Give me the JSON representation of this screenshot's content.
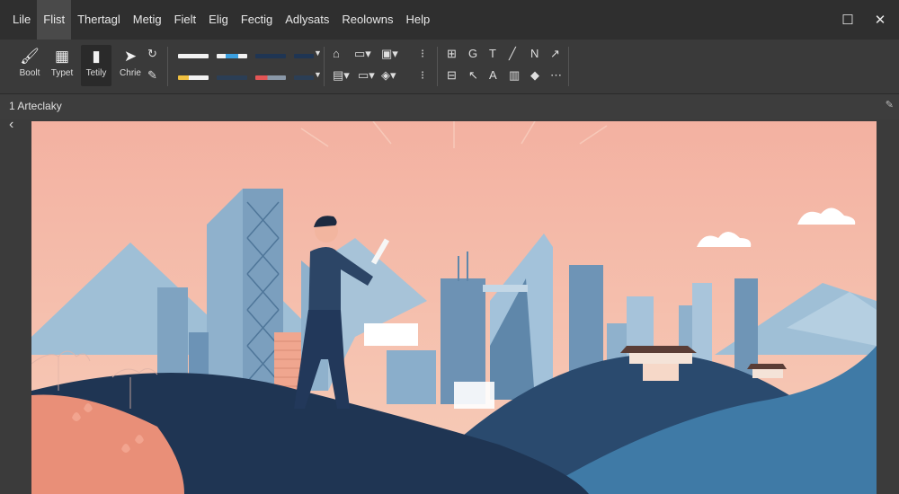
{
  "menu": [
    "Lile",
    "Flist",
    "Thertagl",
    "Metig",
    "Fielt",
    "Elig",
    "Fectig",
    "Adlysats",
    "Reolowns",
    "Help"
  ],
  "active_menu_index": 1,
  "window": {
    "maximize_icon": "maximize-icon",
    "close_icon": "close-icon"
  },
  "toolbar": {
    "tools": [
      {
        "label": "Boolt",
        "icon": "brush-icon"
      },
      {
        "label": "Typet",
        "icon": "basket-icon"
      },
      {
        "label": "Tetily",
        "icon": "page-icon"
      },
      {
        "label": "Chrie",
        "icon": "cursor-icon"
      }
    ],
    "active_tool_index": 2
  },
  "document": {
    "title": "1 Arteclaky"
  },
  "colors": {
    "sky_top": "#f3b3a3",
    "sky_bottom": "#f6c6b2",
    "building": "#8fb1cc",
    "building_dark": "#5f87aa",
    "hill_dark": "#1f3553",
    "hill_mid": "#2f5f86",
    "hill_light": "#6f9cc0",
    "coral": "#e98f78"
  }
}
